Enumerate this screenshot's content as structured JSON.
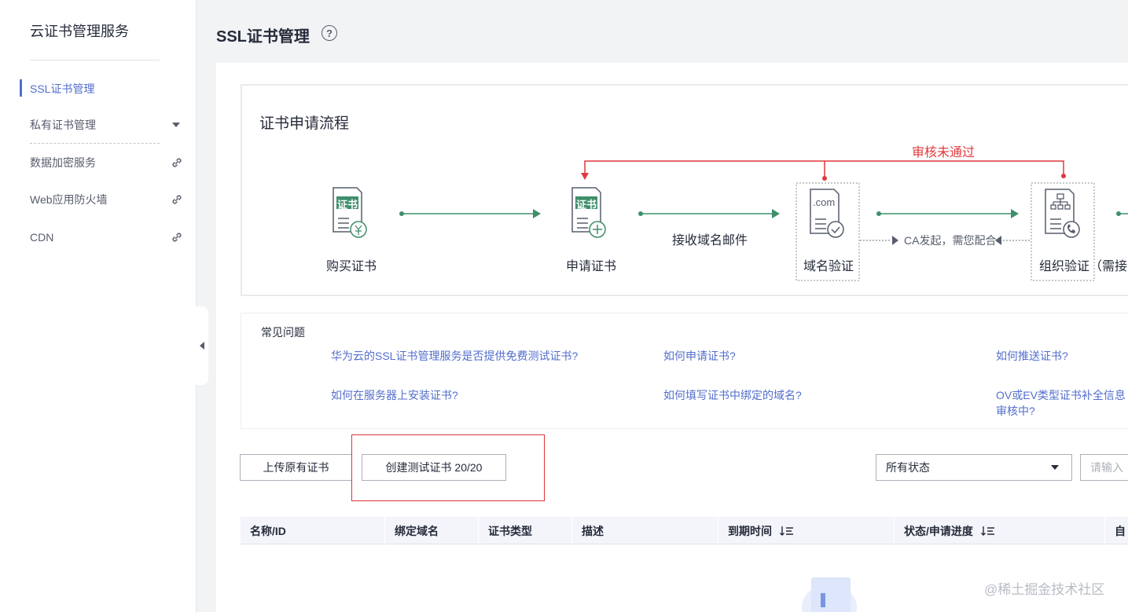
{
  "sidebar": {
    "title": "云证书管理服务",
    "items": [
      {
        "label": "SSL证书管理"
      },
      {
        "label": "私有证书管理"
      },
      {
        "label": "数据加密服务"
      },
      {
        "label": "Web应用防火墙"
      },
      {
        "label": "CDN"
      }
    ]
  },
  "header": {
    "title": "SSL证书管理",
    "help": "?"
  },
  "flow": {
    "title": "证书申请流程",
    "steps": [
      {
        "label": "购买证书",
        "badge": "证书"
      },
      {
        "label": "申请证书",
        "badge": "证书"
      },
      {
        "label": "域名验证",
        "badge": ".com"
      },
      {
        "label": "组织验证（需接电",
        "badge": ""
      }
    ],
    "email_label": "接收域名邮件",
    "ca_label": "CA发起，需您配合",
    "reject_label": "审核未通过"
  },
  "faq": {
    "title": "常见问题",
    "links": [
      "华为云的SSL证书管理服务是否提供免费测试证书?",
      "如何申请证书?",
      "如何推送证书?",
      "如何在服务器上安装证书?",
      "如何填写证书中绑定的域名?",
      "OV或EV类型证书补全信息",
      "审核中?"
    ]
  },
  "toolbar": {
    "upload_label": "上传原有证书",
    "create_test_label": "创建测试证书 20/20",
    "status_select": "所有状态",
    "search_placeholder": "请输入"
  },
  "table": {
    "columns": [
      "名称/ID",
      "绑定域名",
      "证书类型",
      "描述",
      "到期时间",
      "状态/申请进度",
      "自"
    ]
  },
  "watermark": "@稀土掘金技术社区",
  "colors": {
    "accent": "#526ecc",
    "flow_green": "#3f8f6b",
    "reject_red": "#e0393e"
  }
}
